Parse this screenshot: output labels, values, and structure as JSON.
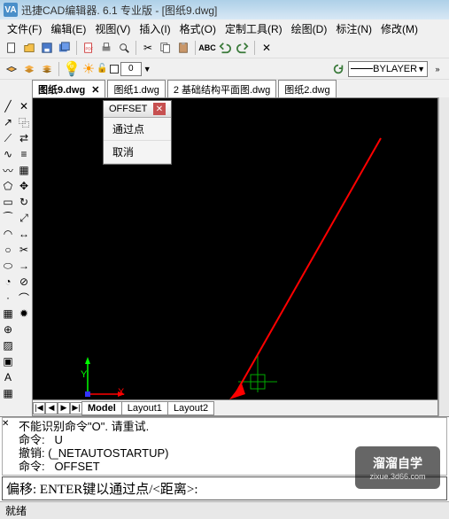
{
  "window": {
    "title": "迅捷CAD编辑器. 6.1 专业版  - [图纸9.dwg]",
    "logo_text": "VA"
  },
  "menus": [
    "文件(F)",
    "编辑(E)",
    "视图(V)",
    "插入(I)",
    "格式(O)",
    "定制工具(R)",
    "绘图(D)",
    "标注(N)",
    "修改(M)"
  ],
  "toolbar2": {
    "num": "0",
    "layer": "0",
    "linetype": "BYLAYER"
  },
  "doc_tabs": [
    {
      "label": "图纸9.dwg",
      "active": true,
      "closable": true
    },
    {
      "label": "图纸1.dwg",
      "active": false,
      "closable": false
    },
    {
      "label": "2 基础结构平面图.dwg",
      "active": false,
      "closable": false
    },
    {
      "label": "图纸2.dwg",
      "active": false,
      "closable": false
    }
  ],
  "axis": {
    "x": "X",
    "y": "Y"
  },
  "context_menu": {
    "title": "OFFSET",
    "items": [
      "通过点",
      "取消"
    ]
  },
  "layout_tabs": {
    "nav": [
      "|◀",
      "◀",
      "▶",
      "▶|"
    ],
    "items": [
      "Model",
      "Layout1",
      "Layout2"
    ]
  },
  "command": {
    "history": "不能识别命令\"O\". 请重试.\n命令:   U\n撤销: (_NETAUTOSTARTUP)\n命令:   OFFSET",
    "prompt": "偏移: ENTER键以通过点/<距离>:"
  },
  "status": "就绪",
  "watermark": {
    "name": "溜溜自学",
    "url": "zixue.3d66.com"
  }
}
